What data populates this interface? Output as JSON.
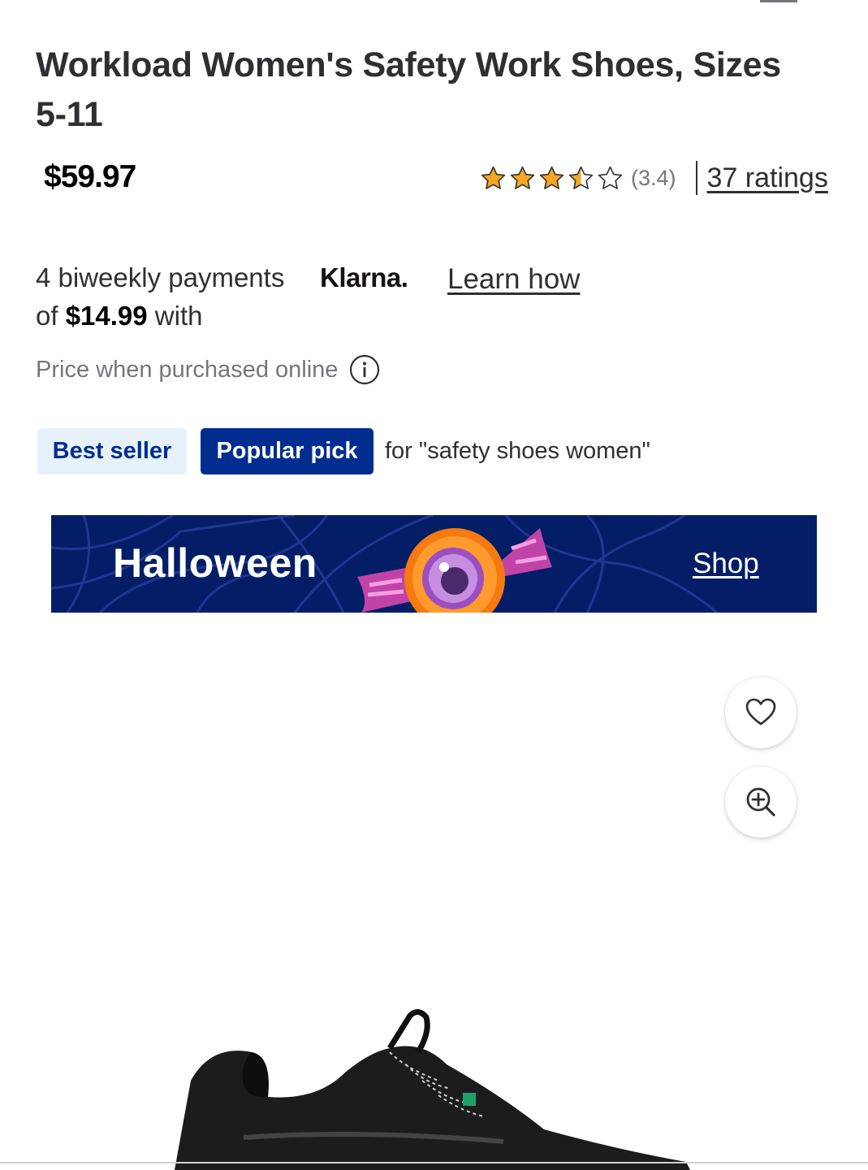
{
  "product": {
    "title": "Workload Women's Safety Work Shoes, Sizes 5-11",
    "price": "$59.97",
    "rating_value": "(3.4)",
    "rating_stars": 3.4,
    "ratings_link": "37 ratings"
  },
  "klarna": {
    "line1": "4 biweekly payments",
    "line2_prefix": "of ",
    "installment": "$14.99",
    "line2_suffix": " with",
    "logo_text": "Klarna.",
    "learn_how": "Learn how"
  },
  "price_note": {
    "text": "Price when purchased online",
    "icon": "info-icon"
  },
  "badges": {
    "best_seller": "Best seller",
    "popular_pick": "Popular pick",
    "for_text": "for \"safety shoes women\""
  },
  "banner": {
    "title": "Halloween",
    "shop_link": "Shop",
    "background": "#031e66"
  },
  "image_actions": {
    "favorite_icon": "heart-icon",
    "zoom_icon": "zoom-in-icon"
  },
  "colors": {
    "accent_blue": "#002d8f",
    "light_blue": "#e6f1fc",
    "star": "#f5a623",
    "text": "#2e2f32",
    "muted": "#74767c"
  }
}
